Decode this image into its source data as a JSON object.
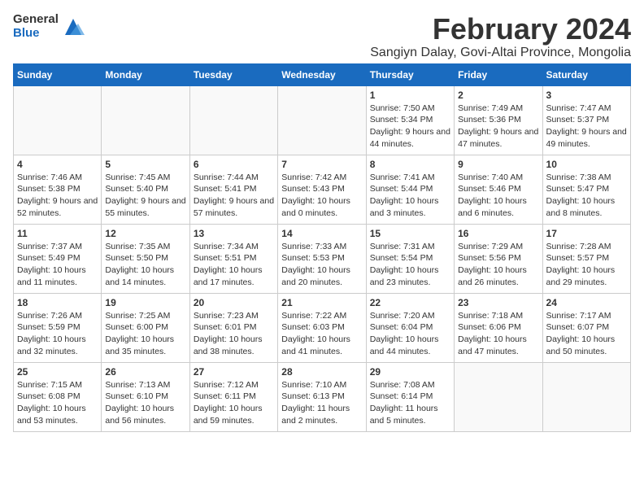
{
  "logo": {
    "general": "General",
    "blue": "Blue"
  },
  "title": "February 2024",
  "subtitle": "Sangiyn Dalay, Govi-Altai Province, Mongolia",
  "days_of_week": [
    "Sunday",
    "Monday",
    "Tuesday",
    "Wednesday",
    "Thursday",
    "Friday",
    "Saturday"
  ],
  "weeks": [
    [
      {
        "day": "",
        "info": ""
      },
      {
        "day": "",
        "info": ""
      },
      {
        "day": "",
        "info": ""
      },
      {
        "day": "",
        "info": ""
      },
      {
        "day": "1",
        "info": "Sunrise: 7:50 AM\nSunset: 5:34 PM\nDaylight: 9 hours and 44 minutes."
      },
      {
        "day": "2",
        "info": "Sunrise: 7:49 AM\nSunset: 5:36 PM\nDaylight: 9 hours and 47 minutes."
      },
      {
        "day": "3",
        "info": "Sunrise: 7:47 AM\nSunset: 5:37 PM\nDaylight: 9 hours and 49 minutes."
      }
    ],
    [
      {
        "day": "4",
        "info": "Sunrise: 7:46 AM\nSunset: 5:38 PM\nDaylight: 9 hours and 52 minutes."
      },
      {
        "day": "5",
        "info": "Sunrise: 7:45 AM\nSunset: 5:40 PM\nDaylight: 9 hours and 55 minutes."
      },
      {
        "day": "6",
        "info": "Sunrise: 7:44 AM\nSunset: 5:41 PM\nDaylight: 9 hours and 57 minutes."
      },
      {
        "day": "7",
        "info": "Sunrise: 7:42 AM\nSunset: 5:43 PM\nDaylight: 10 hours and 0 minutes."
      },
      {
        "day": "8",
        "info": "Sunrise: 7:41 AM\nSunset: 5:44 PM\nDaylight: 10 hours and 3 minutes."
      },
      {
        "day": "9",
        "info": "Sunrise: 7:40 AM\nSunset: 5:46 PM\nDaylight: 10 hours and 6 minutes."
      },
      {
        "day": "10",
        "info": "Sunrise: 7:38 AM\nSunset: 5:47 PM\nDaylight: 10 hours and 8 minutes."
      }
    ],
    [
      {
        "day": "11",
        "info": "Sunrise: 7:37 AM\nSunset: 5:49 PM\nDaylight: 10 hours and 11 minutes."
      },
      {
        "day": "12",
        "info": "Sunrise: 7:35 AM\nSunset: 5:50 PM\nDaylight: 10 hours and 14 minutes."
      },
      {
        "day": "13",
        "info": "Sunrise: 7:34 AM\nSunset: 5:51 PM\nDaylight: 10 hours and 17 minutes."
      },
      {
        "day": "14",
        "info": "Sunrise: 7:33 AM\nSunset: 5:53 PM\nDaylight: 10 hours and 20 minutes."
      },
      {
        "day": "15",
        "info": "Sunrise: 7:31 AM\nSunset: 5:54 PM\nDaylight: 10 hours and 23 minutes."
      },
      {
        "day": "16",
        "info": "Sunrise: 7:29 AM\nSunset: 5:56 PM\nDaylight: 10 hours and 26 minutes."
      },
      {
        "day": "17",
        "info": "Sunrise: 7:28 AM\nSunset: 5:57 PM\nDaylight: 10 hours and 29 minutes."
      }
    ],
    [
      {
        "day": "18",
        "info": "Sunrise: 7:26 AM\nSunset: 5:59 PM\nDaylight: 10 hours and 32 minutes."
      },
      {
        "day": "19",
        "info": "Sunrise: 7:25 AM\nSunset: 6:00 PM\nDaylight: 10 hours and 35 minutes."
      },
      {
        "day": "20",
        "info": "Sunrise: 7:23 AM\nSunset: 6:01 PM\nDaylight: 10 hours and 38 minutes."
      },
      {
        "day": "21",
        "info": "Sunrise: 7:22 AM\nSunset: 6:03 PM\nDaylight: 10 hours and 41 minutes."
      },
      {
        "day": "22",
        "info": "Sunrise: 7:20 AM\nSunset: 6:04 PM\nDaylight: 10 hours and 44 minutes."
      },
      {
        "day": "23",
        "info": "Sunrise: 7:18 AM\nSunset: 6:06 PM\nDaylight: 10 hours and 47 minutes."
      },
      {
        "day": "24",
        "info": "Sunrise: 7:17 AM\nSunset: 6:07 PM\nDaylight: 10 hours and 50 minutes."
      }
    ],
    [
      {
        "day": "25",
        "info": "Sunrise: 7:15 AM\nSunset: 6:08 PM\nDaylight: 10 hours and 53 minutes."
      },
      {
        "day": "26",
        "info": "Sunrise: 7:13 AM\nSunset: 6:10 PM\nDaylight: 10 hours and 56 minutes."
      },
      {
        "day": "27",
        "info": "Sunrise: 7:12 AM\nSunset: 6:11 PM\nDaylight: 10 hours and 59 minutes."
      },
      {
        "day": "28",
        "info": "Sunrise: 7:10 AM\nSunset: 6:13 PM\nDaylight: 11 hours and 2 minutes."
      },
      {
        "day": "29",
        "info": "Sunrise: 7:08 AM\nSunset: 6:14 PM\nDaylight: 11 hours and 5 minutes."
      },
      {
        "day": "",
        "info": ""
      },
      {
        "day": "",
        "info": ""
      }
    ]
  ]
}
